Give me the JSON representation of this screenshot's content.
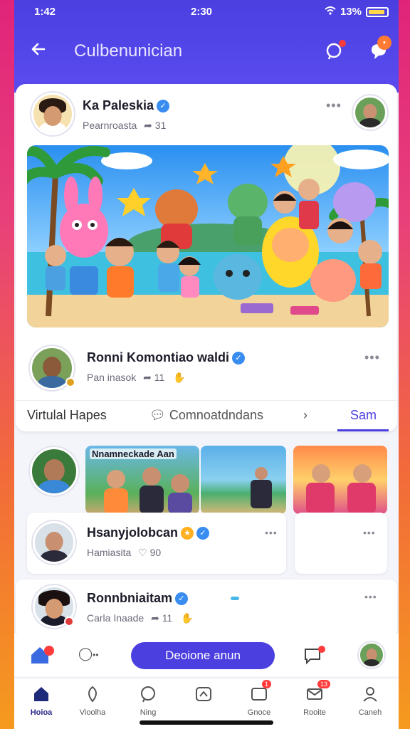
{
  "status": {
    "time": "1:42",
    "center": "2:30",
    "battery": "13%"
  },
  "header": {
    "title": "Culbenunician",
    "back_icon": "arrow-left-icon"
  },
  "post1": {
    "name": "Ka Paleskia",
    "sub": "Pearnroasta",
    "count": "31"
  },
  "post2": {
    "name": "Ronni Komontiao waldi",
    "sub": "Pan inasok",
    "count": "11"
  },
  "tabs": {
    "tab1": "Virtulal Hapes",
    "tab2": "Comnoatdndans",
    "tab3": "Sam"
  },
  "strip": {
    "label": "Nnamneckade Aan"
  },
  "card_a": {
    "name": "Hsanyjolobcan",
    "sub": "Hamiasita",
    "count": "90"
  },
  "card_b": {
    "name": "Ronnbniaitam",
    "sub": "Carla Inaade",
    "count": "11"
  },
  "cta": {
    "label": "Deoione anun"
  },
  "tabbar": {
    "items": [
      {
        "label": "Hoioa",
        "icon": "home-icon"
      },
      {
        "label": "Vioolha",
        "icon": "leaf-icon"
      },
      {
        "label": "Ning",
        "icon": "chat-icon"
      },
      {
        "label": "",
        "icon": "share-icon"
      },
      {
        "label": "Gnoce",
        "icon": "message-icon",
        "badge": "1"
      },
      {
        "label": "Rooite",
        "icon": "mail-icon",
        "badge": "13"
      },
      {
        "label": "Caneh",
        "icon": "person-icon"
      }
    ]
  },
  "colors": {
    "primary": "#4b3fe0",
    "accent_red": "#ff3b3b",
    "verified": "#3a8df0"
  }
}
